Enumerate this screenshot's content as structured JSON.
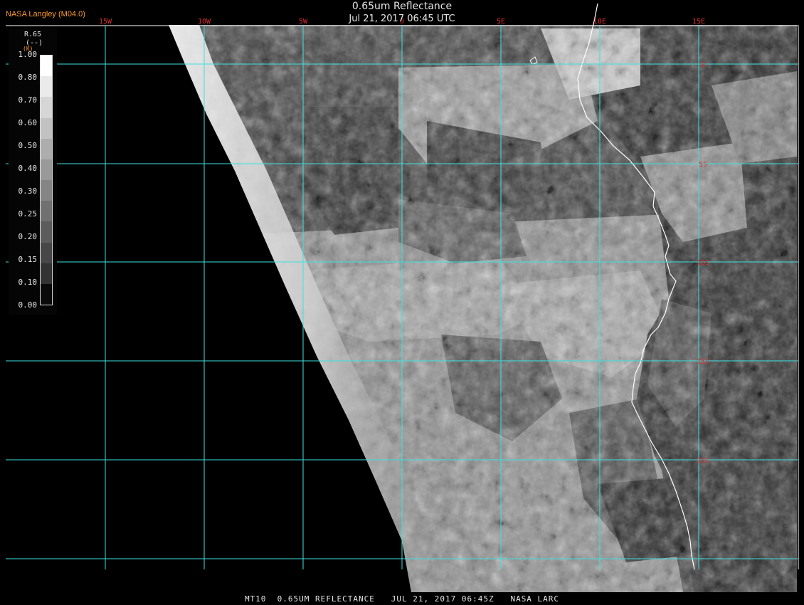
{
  "header": {
    "source": "NASA Langley (M04.0)",
    "title": "0.65um Reflectance",
    "timestamp": "Jul 21, 2017 06:45 UTC"
  },
  "footer": {
    "caption": "MT10  0.65UM REFLECTANCE   JUL 21, 2017 06:45Z   NASA LARC"
  },
  "map": {
    "lon_labels": [
      "15W",
      "10W",
      "5W",
      "0",
      "5E",
      "10E",
      "15E"
    ],
    "lat_labels": [
      "0",
      "5S",
      "10S",
      "15S",
      "20S"
    ],
    "grid_color": "#3fe0e0",
    "label_color": "#e03030",
    "coast_color": "#ffffff",
    "frame_color": "#ffffff"
  },
  "legend": {
    "title": "R.65",
    "units": "(--)",
    "marker": "(K)",
    "ticks": [
      "1.00",
      "0.80",
      "0.70",
      "0.60",
      "0.50",
      "0.40",
      "0.30",
      "0.25",
      "0.20",
      "0.15",
      "0.10",
      "0.00"
    ],
    "colors": [
      "#ffffff",
      "#eaeaea",
      "#d6d6d6",
      "#c2c2c2",
      "#adadad",
      "#999999",
      "#858585",
      "#707070",
      "#5c5c5c",
      "#474747",
      "#333333",
      "#0a0a0a"
    ]
  }
}
